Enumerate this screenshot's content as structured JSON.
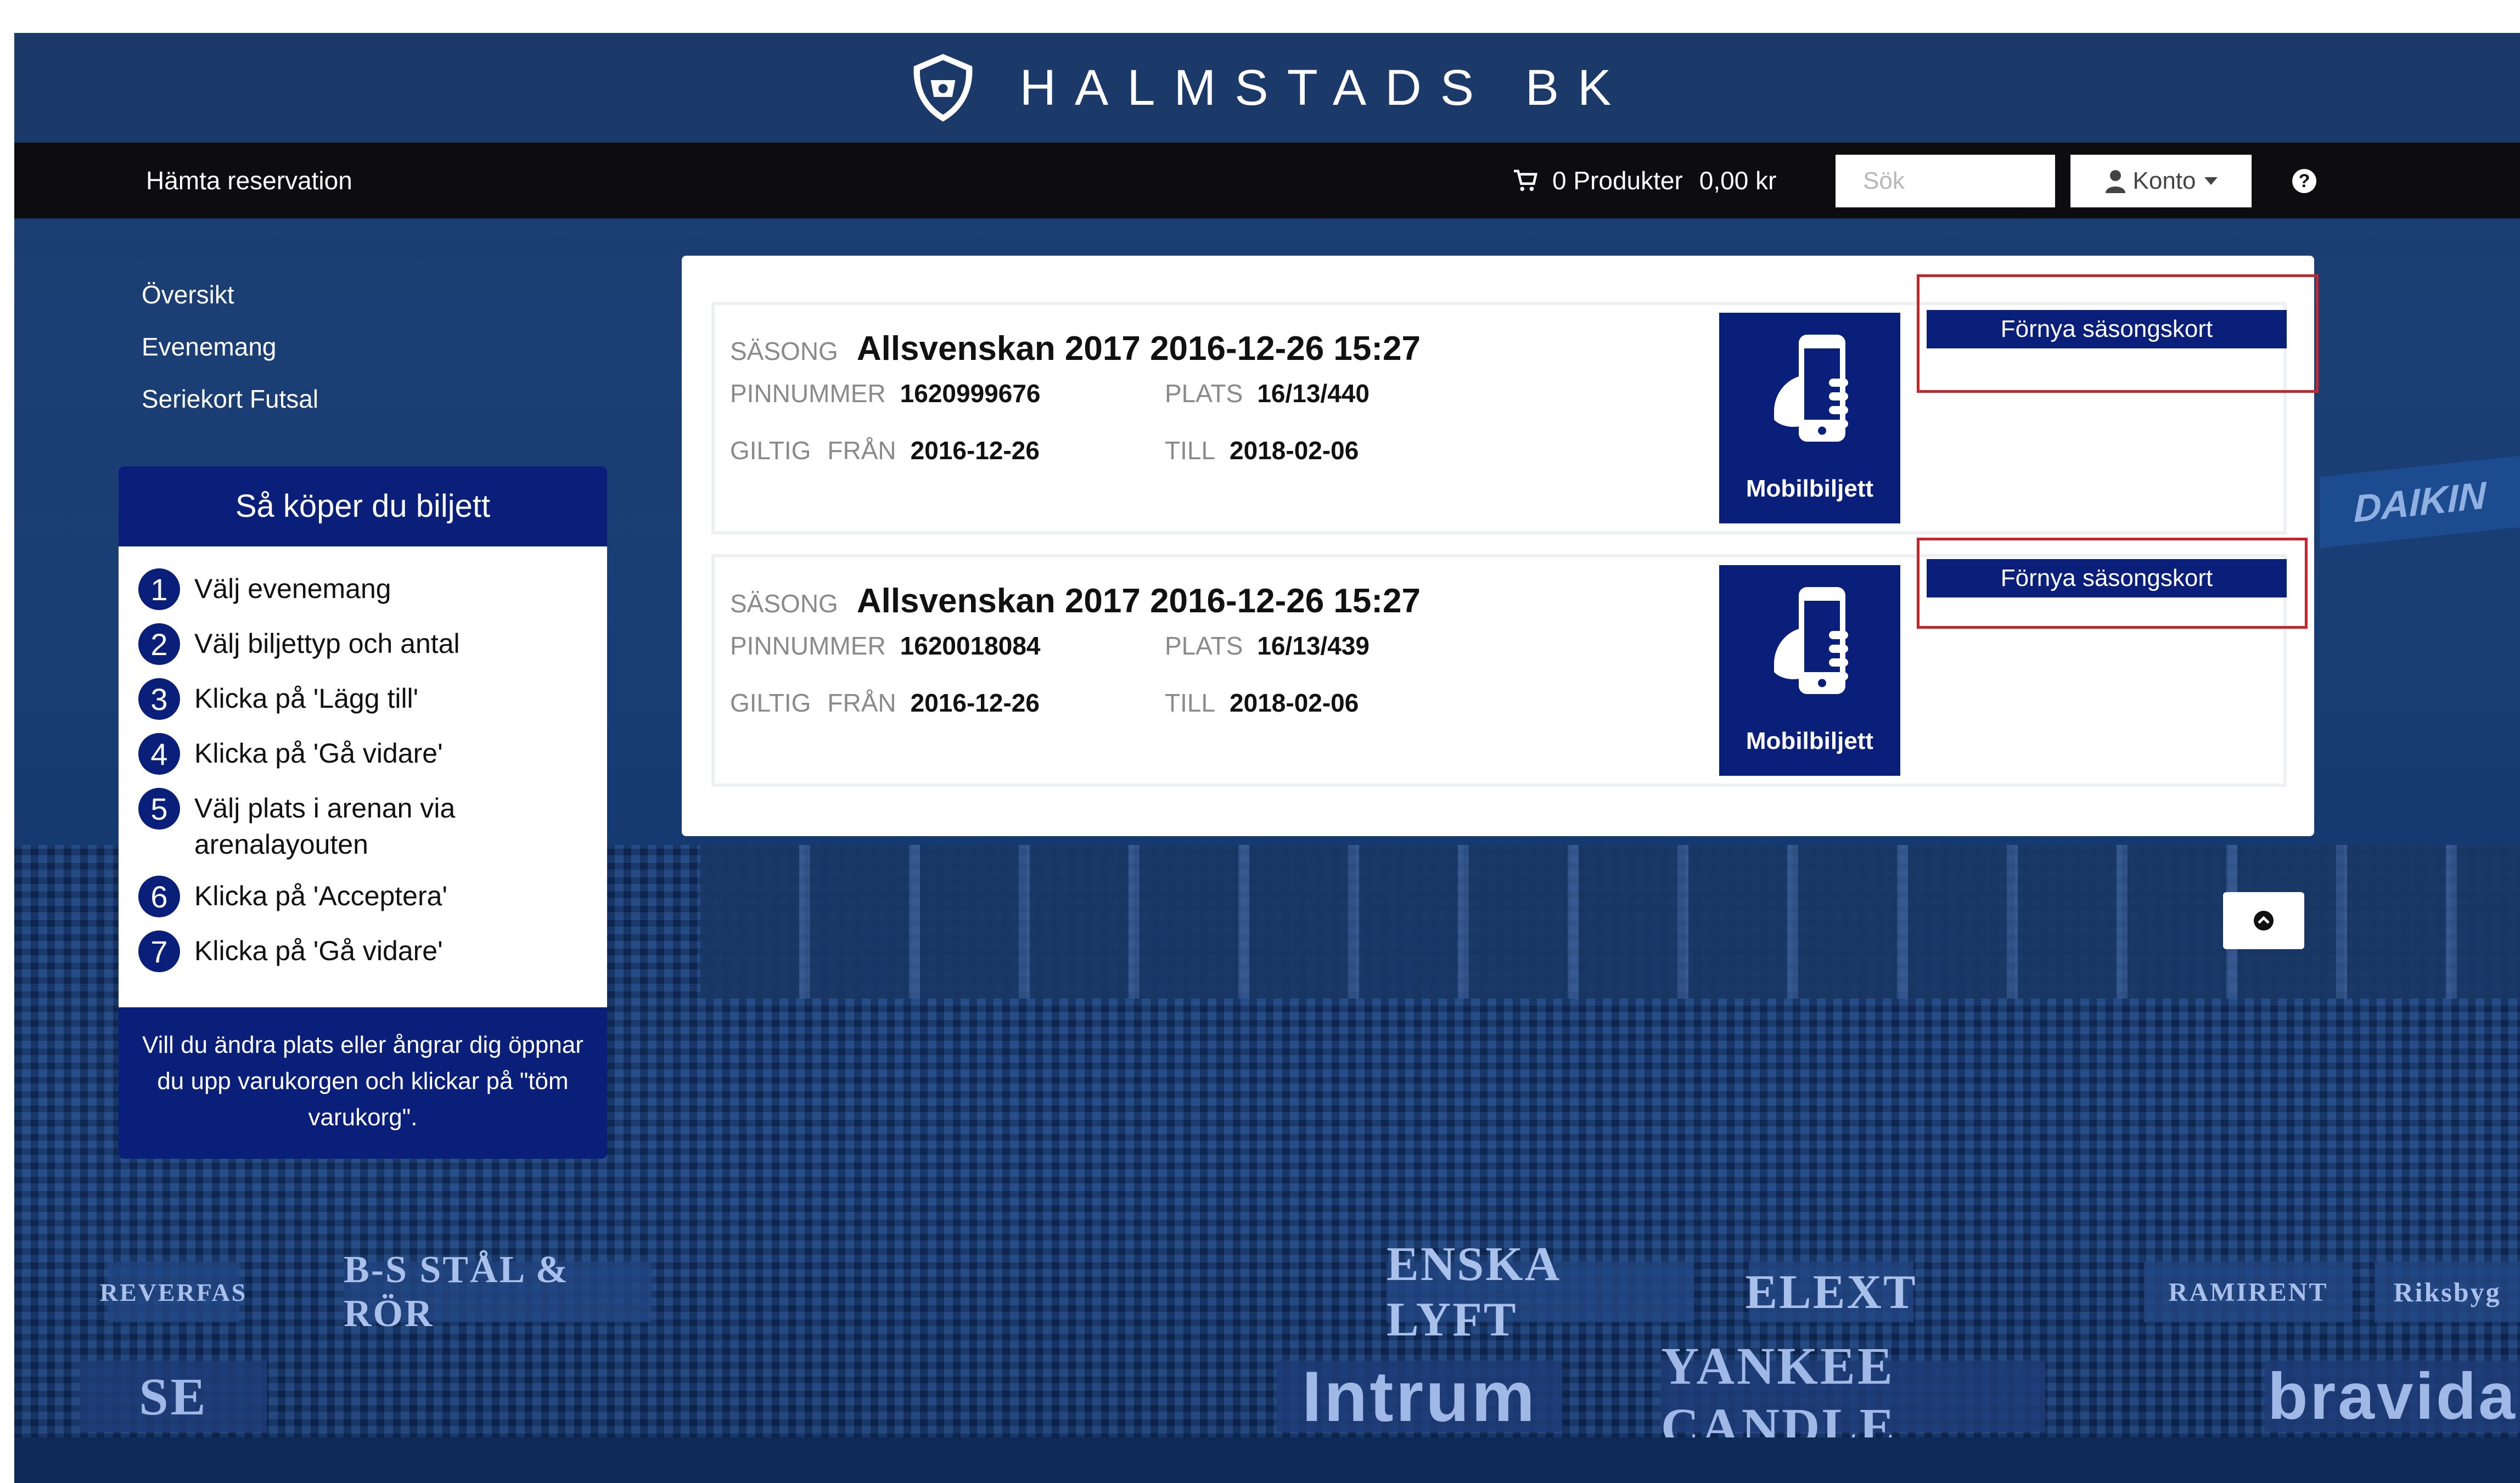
{
  "brand": {
    "name": "HALMSTADS BK",
    "color_primary": "#1b3a6a",
    "color_accent": "#0a1f7a",
    "highlight": "#c8262c"
  },
  "topbar": {
    "reservation_label": "Hämta reservation",
    "cart_label": "0 Produkter",
    "cart_total": "0,00 kr",
    "search_placeholder": "Sök",
    "account_label": "Konto",
    "help_icon": "?"
  },
  "nav": {
    "items": [
      "Översikt",
      "Evenemang",
      "Seriekort Futsal"
    ]
  },
  "howto": {
    "title": "Så köper du biljett",
    "steps": [
      {
        "num": "1",
        "text": "Välj evenemang"
      },
      {
        "num": "2",
        "text": "Välj biljettyp och antal"
      },
      {
        "num": "3",
        "text": "Klicka på 'Lägg till'"
      },
      {
        "num": "4",
        "text": "Klicka på 'Gå vidare'"
      },
      {
        "num": "5",
        "text": "Välj plats i arenan via arenalayouten"
      },
      {
        "num": "6",
        "text": "Klicka på 'Acceptera'"
      },
      {
        "num": "7",
        "text": "Klicka på 'Gå vidare'"
      }
    ],
    "footer": "Vill du ändra plats eller ångrar dig öppnar du upp varukorgen och klickar på \"töm varukorg\"."
  },
  "seasons": [
    {
      "label_season": "SÄSONG",
      "title": "Allsvenskan 2017 2016-12-26 15:27",
      "label_pin": "PINNUMMER",
      "pin": "1620999676",
      "label_seat": "PLATS",
      "seat": "16/13/440",
      "label_valid": "GILTIG",
      "label_from": "FRÅN",
      "from": "2016-12-26",
      "label_to": "TILL",
      "to": "2018-02-06",
      "mobile_label": "Mobilbiljett",
      "renew_label": "Förnya säsongskort"
    },
    {
      "label_season": "SÄSONG",
      "title": "Allsvenskan 2017 2016-12-26 15:27",
      "label_pin": "PINNUMMER",
      "pin": "1620018084",
      "label_seat": "PLATS",
      "seat": "16/13/439",
      "label_valid": "GILTIG",
      "label_from": "FRÅN",
      "from": "2016-12-26",
      "label_to": "TILL",
      "to": "2018-02-06",
      "mobile_label": "Mobilbiljett",
      "renew_label": "Förnya säsongskort"
    }
  ],
  "background_ads": [
    "DAIKIN",
    "ENSKA LYFT",
    "ELEXT",
    "RAMIRENT",
    "Riksbyg",
    "B-S STÅL & RÖR",
    "REVERFAS",
    "YANKEE CANDLE",
    "bravida",
    "Intrum",
    "SE"
  ]
}
